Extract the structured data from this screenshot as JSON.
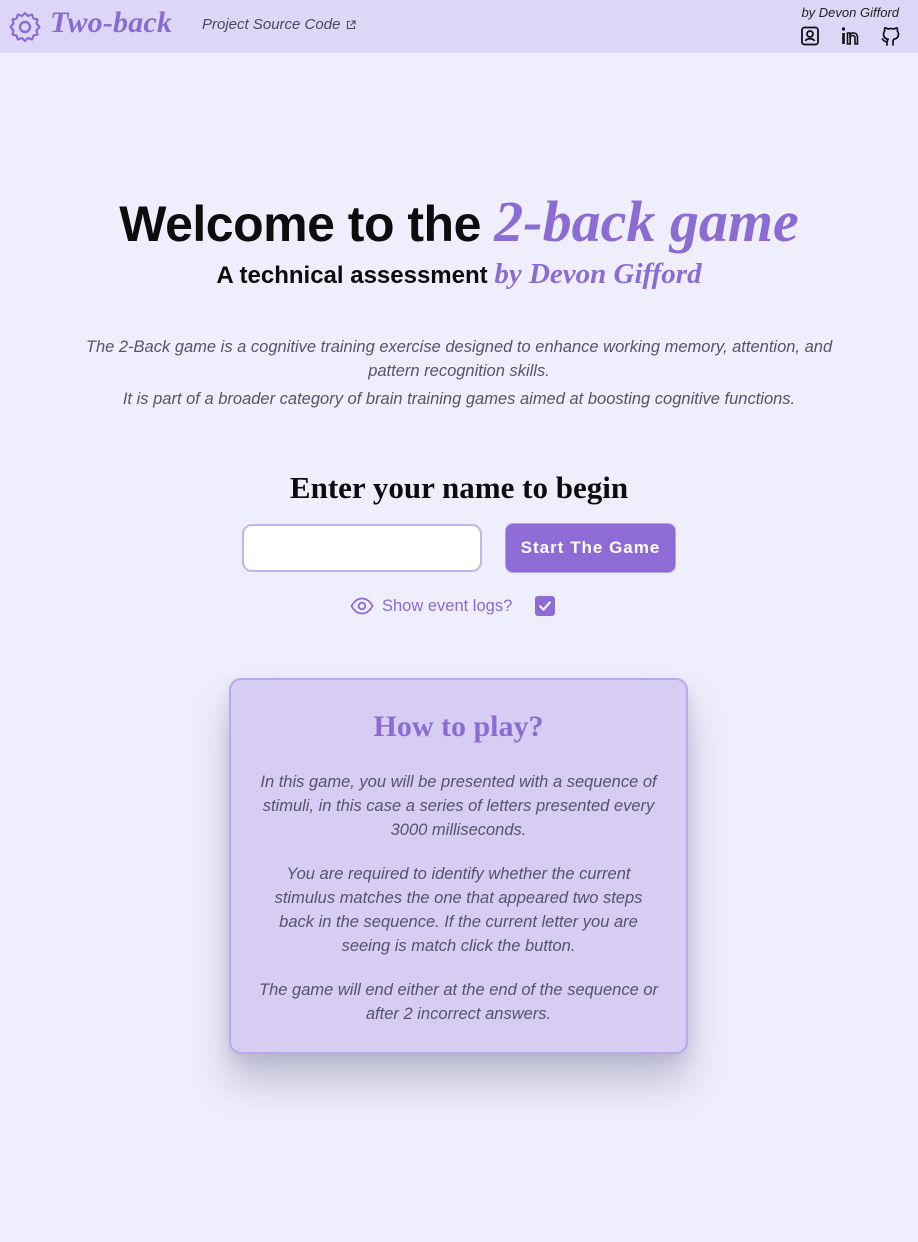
{
  "header": {
    "logo_text": "Two-back",
    "source_link": "Project Source Code",
    "byline": "by Devon Gifford",
    "social": [
      "contact-icon",
      "linkedin-icon",
      "github-icon"
    ]
  },
  "hero": {
    "title_plain": "Welcome to the ",
    "title_accent": "2-back game",
    "subtitle_plain": "A technical assessment ",
    "subtitle_accent": "by Devon Gifford",
    "description": [
      "The 2-Back game is a cognitive training exercise designed to enhance working memory, attention, and pattern recognition skills.",
      "It is part of a broader category of brain training games aimed at boosting cognitive functions."
    ]
  },
  "start": {
    "title": "Enter your name to begin",
    "name_value": "",
    "button_label": "Start The Game",
    "logs_label": "Show event logs?",
    "logs_checked": true
  },
  "how_to_play": {
    "title": "How to play?",
    "paragraphs": [
      "In this game, you will be presented with a sequence of stimuli, in this case a series of letters presented every 3000 milliseconds.",
      "You are required to identify whether the current stimulus matches the one that appeared two steps back in the sequence. If the current letter you are seeing is match click the button.",
      "The game will end either at the end of the sequence or after 2 incorrect answers."
    ]
  },
  "colors": {
    "accent": "#8c6bd3",
    "header_bg": "#ddd6f6",
    "page_bg": "#efeefc",
    "card_bg": "#d6ccf4"
  }
}
